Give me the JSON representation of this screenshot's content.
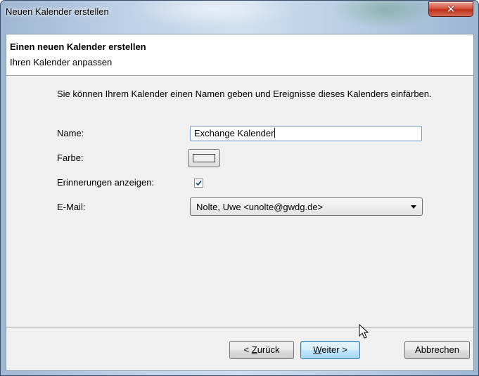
{
  "window": {
    "title": "Neuen Kalender erstellen",
    "close_symbol": "✕"
  },
  "header": {
    "title": "Einen neuen Kalender erstellen",
    "subtitle": "Ihren Kalender anpassen"
  },
  "form": {
    "description": "Sie können Ihrem Kalender einen Namen geben und Ereignisse dieses Kalenders einfärben.",
    "name_label": "Name:",
    "name_value": "Exchange Kalender",
    "color_label": "Farbe:",
    "reminders_label": "Erinnerungen anzeigen:",
    "reminders_checked": true,
    "email_label": "E-Mail:",
    "email_value": "Nolte, Uwe <unolte@gwdg.de>"
  },
  "buttons": {
    "back_prefix": "< ",
    "back_accesskey": "Z",
    "back_rest": "urück",
    "next_accesskey": "W",
    "next_rest": "eiter >",
    "cancel": "Abbrechen"
  },
  "colors": {
    "close_button": "#c0321c",
    "default_button_border": "#3c7fb1",
    "input_border": "#7a9cc4",
    "dialog_background": "#f0f0f0"
  },
  "icons": {
    "close": "close-icon",
    "dropdown": "chevron-down-icon",
    "cursor": "mouse-pointer-icon",
    "check": "checkmark-icon"
  }
}
